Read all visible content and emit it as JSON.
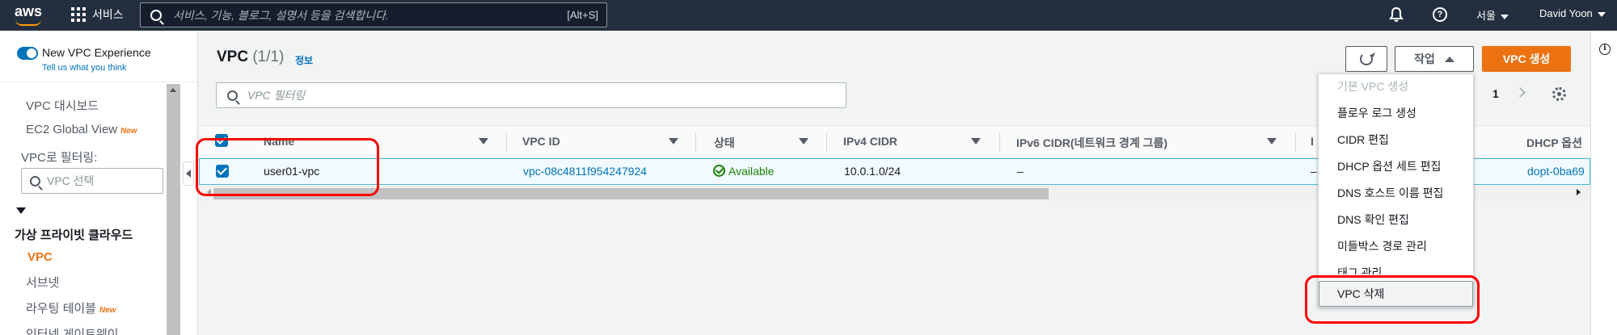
{
  "topbar": {
    "logo": "aws",
    "services_label": "서비스",
    "search_placeholder": "서비스, 기능, 블로그, 설명서 등을 검색합니다.",
    "search_hotkey": "[Alt+S]",
    "region": "서울",
    "user": "David Yoon"
  },
  "sidebar": {
    "new_vpc_experience": "New VPC Experience",
    "tell_us": "Tell us what you think",
    "items": [
      {
        "label": "VPC 대시보드",
        "badge": ""
      },
      {
        "label": "EC2 Global View",
        "badge": "New"
      }
    ],
    "filter_label": "VPC로 필터링:",
    "vpc_select_placeholder": "VPC 선택",
    "group_title": "가상 프라이빗 클라우드",
    "group_items": [
      {
        "label": "VPC",
        "active": true,
        "badge": ""
      },
      {
        "label": "서브넷",
        "active": false,
        "badge": ""
      },
      {
        "label": "라우팅 테이블",
        "active": false,
        "badge": "New"
      },
      {
        "label": "인터넷 게이트웨이",
        "active": false,
        "badge": ""
      }
    ]
  },
  "page": {
    "title": "VPC",
    "count": "(1/1)",
    "info_link": "정보",
    "actions_label": "작업",
    "create_label": "VPC 생성",
    "filter_placeholder": "VPC 필터링",
    "page_number": "1"
  },
  "table": {
    "columns": [
      "Name",
      "VPC ID",
      "상태",
      "IPv4 CIDR",
      "IPv6 CIDR(네트워크 경계 그룹)",
      "I",
      "DHCP 옵션"
    ],
    "rows": [
      {
        "name": "user01-vpc",
        "vpc_id": "vpc-08c4811f954247924",
        "state": "Available",
        "ipv4": "10.0.1.0/24",
        "ipv6": "–",
        "col6": "–",
        "dhcp": "dopt-0ba69"
      }
    ]
  },
  "actions_menu": {
    "items": [
      {
        "label": "기본 VPC 생성",
        "disabled": true
      },
      {
        "label": "플로우 로그 생성",
        "disabled": false
      },
      {
        "label": "CIDR 편집",
        "disabled": false
      },
      {
        "label": "DHCP 옵션 세트 편집",
        "disabled": false
      },
      {
        "label": "DNS 호스트 이름 편집",
        "disabled": false
      },
      {
        "label": "DNS 확인 편집",
        "disabled": false
      },
      {
        "label": "미들박스 경로 관리",
        "disabled": false
      },
      {
        "label": "태그 관리",
        "disabled": false
      },
      {
        "label": "VPC 삭제",
        "disabled": false
      }
    ]
  },
  "colors": {
    "topbar_bg": "#232f3e",
    "accent_orange": "#ec7211",
    "link_blue": "#0073bb",
    "status_green": "#1d8102",
    "highlight_red": "#ff0000"
  }
}
